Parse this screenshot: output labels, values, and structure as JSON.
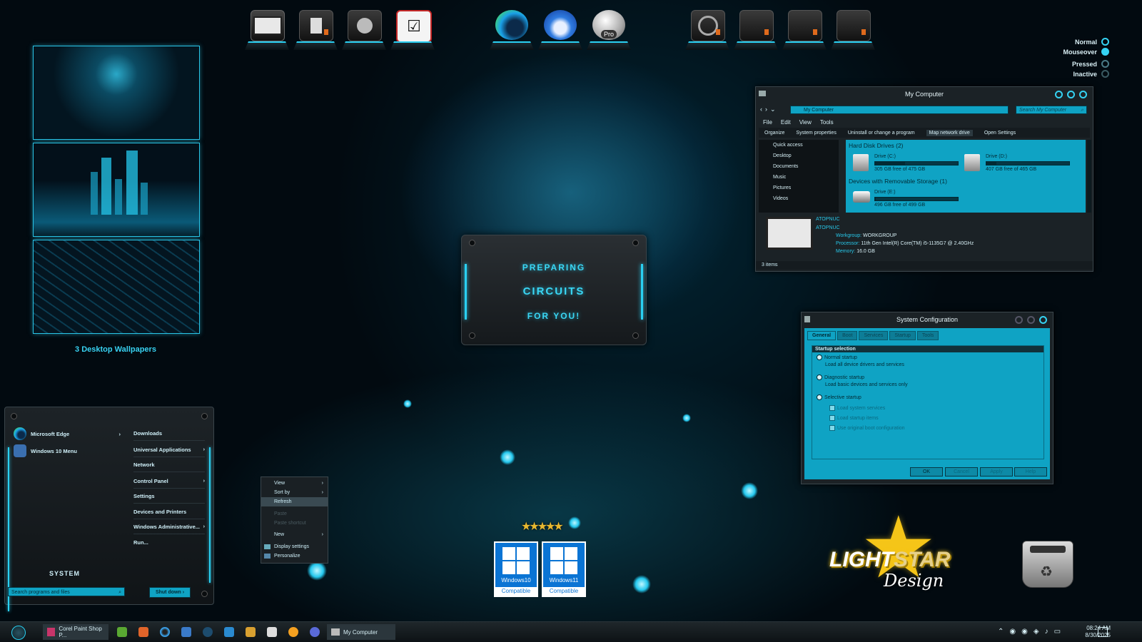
{
  "dock": {
    "items": [
      {
        "name": "computer-icon"
      },
      {
        "name": "documents-folder-icon"
      },
      {
        "name": "network-icon"
      },
      {
        "name": "tasks-icon"
      },
      {
        "name": "edge-icon"
      },
      {
        "name": "thunderbird-icon"
      },
      {
        "name": "google-earth-pro-icon",
        "badge": "Pro"
      },
      {
        "name": "media-folder-icon"
      },
      {
        "name": "folder-icon"
      },
      {
        "name": "folder-icon"
      },
      {
        "name": "folder-icon"
      }
    ]
  },
  "states": [
    "Normal",
    "Mouseover",
    "Pressed",
    "Inactive"
  ],
  "wallpapers": {
    "caption": "3 Desktop Wallpapers"
  },
  "splash": {
    "line1": "PREPARING",
    "line2": "CIRCUITS",
    "line3": "FOR YOU!"
  },
  "my_computer": {
    "title": "My Computer",
    "address": "My Computer",
    "search_placeholder": "Search My Computer",
    "menu": [
      "File",
      "Edit",
      "View",
      "Tools"
    ],
    "commands": [
      "Organize",
      "System properties",
      "Uninstall or change a program",
      "Map network drive",
      "Open Settings"
    ],
    "nav": [
      "Quick access",
      "Desktop",
      "Documents",
      "Music",
      "Pictures",
      "Videos"
    ],
    "group_hdd": "Hard Disk Drives (2)",
    "group_removable": "Devices with Removable Storage (1)",
    "drives": [
      {
        "label": "Drive (C:)",
        "free": "305 GB free of 475 GB",
        "used_fraction": 0.36
      },
      {
        "label": "Drive (D:)",
        "free": "407 GB free of 465 GB",
        "used_fraction": 0.12
      },
      {
        "label": "Drive (E:)",
        "free": "496 GB free of 499 GB",
        "used_fraction": 0.01
      }
    ],
    "pc_name": "ATOPNUC",
    "pc_name2": "ATOPNUC",
    "workgroup_label": "Workgroup:",
    "workgroup": "WORKGROUP",
    "processor_label": "Processor:",
    "processor": "11th Gen Intel(R) Core(TM) i5-1135G7 @ 2.40GHz",
    "memory_label": "Memory:",
    "memory": "16.0 GB",
    "status": "3 items"
  },
  "sysconfig": {
    "title": "System Configuration",
    "tabs": [
      "General",
      "Boot",
      "Services",
      "Startup",
      "Tools"
    ],
    "group": "Startup selection",
    "normal": "Normal startup",
    "normal_desc": "Load all device drivers and services",
    "diag": "Diagnostic startup",
    "diag_desc": "Load basic devices and services only",
    "selective": "Selective startup",
    "checks": [
      "Load system services",
      "Load startup items",
      "Use original boot configuration"
    ],
    "buttons": [
      "OK",
      "Cancel",
      "Apply",
      "Help"
    ]
  },
  "start_menu": {
    "programs": [
      "Microsoft Edge",
      "Windows 10 Menu"
    ],
    "places": [
      "Downloads",
      "Universal Applications",
      "Network",
      "Control Panel",
      "Settings",
      "Devices and Printers",
      "Windows Administrative...",
      "Run..."
    ],
    "system_label": "SYSTEM",
    "search_placeholder": "Search programs and files",
    "shutdown": "Shut down"
  },
  "context_menu": {
    "items": [
      "View",
      "Sort by",
      "Refresh",
      "Paste",
      "Paste shortcut",
      "New",
      "Display settings",
      "Personalize"
    ]
  },
  "badges": {
    "win10": "Windows10",
    "win11": "Windows11",
    "compatible": "Compatible"
  },
  "branding": {
    "light": "LIGHT",
    "star": "STAR",
    "design": "Design"
  },
  "taskbar": {
    "app1": "Corel Paint Shop P...",
    "app2": "My Computer",
    "time": "08:24 AM",
    "date": "8/30/2025"
  },
  "colors": {
    "accent": "#2ad0f2",
    "panel": "#0fa3c4",
    "dark": "#1b2226"
  }
}
